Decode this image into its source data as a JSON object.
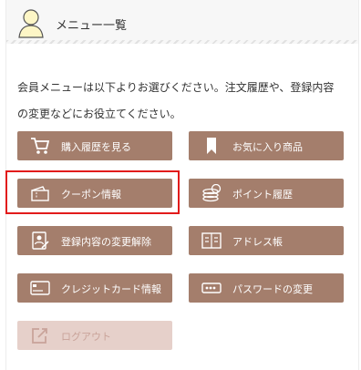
{
  "header": {
    "title": "メニュー一覧",
    "icon": "user-icon"
  },
  "intro": {
    "line1": "会員メニューは以下よりお選びください。注文履歴や、登録内容",
    "line2": "の変更などにお役立てください。"
  },
  "menu": {
    "order_history": {
      "label": "購入履歴を見る",
      "icon": "cart-icon"
    },
    "favorites": {
      "label": "お気に入り商品",
      "icon": "bookmark-icon"
    },
    "coupons": {
      "label": "クーポン情報",
      "icon": "coupon-icon"
    },
    "points": {
      "label": "ポイント履歴",
      "icon": "coins-icon"
    },
    "account_change": {
      "label": "登録内容の変更解除",
      "icon": "profile-edit-icon"
    },
    "address_book": {
      "label": "アドレス帳",
      "icon": "address-book-icon"
    },
    "credit_card": {
      "label": "クレジットカード情報",
      "icon": "credit-card-icon"
    },
    "password": {
      "label": "パスワードの変更",
      "icon": "password-icon"
    },
    "logout": {
      "label": "ログアウト",
      "icon": "logout-icon"
    }
  },
  "colors": {
    "button_bg": "#a47e6c",
    "button_disabled_bg": "#e6d0ca",
    "highlight_border": "#e21b1b"
  }
}
